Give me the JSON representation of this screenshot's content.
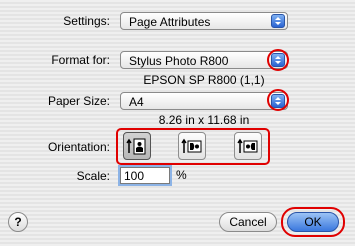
{
  "settings": {
    "label": "Settings:",
    "value": "Page Attributes"
  },
  "format_for": {
    "label": "Format for:",
    "value": "Stylus Photo R800",
    "printer_detail": "EPSON SP R800 (1,1)"
  },
  "paper_size": {
    "label": "Paper Size:",
    "value": "A4",
    "dimensions": "8.26 in x 11.68 in"
  },
  "orientation": {
    "label": "Orientation:",
    "options": [
      {
        "name": "portrait",
        "icon": "portrait-orientation-icon",
        "selected": true
      },
      {
        "name": "landscape-left",
        "icon": "landscape-left-orientation-icon",
        "selected": false
      },
      {
        "name": "landscape-right",
        "icon": "landscape-right-orientation-icon",
        "selected": false
      }
    ]
  },
  "scale": {
    "label": "Scale:",
    "value": "100",
    "unit": "%"
  },
  "buttons": {
    "help": "?",
    "cancel": "Cancel",
    "ok": "OK"
  },
  "colors": {
    "highlight": "#e00000",
    "accent_blue": "#3a78de"
  }
}
